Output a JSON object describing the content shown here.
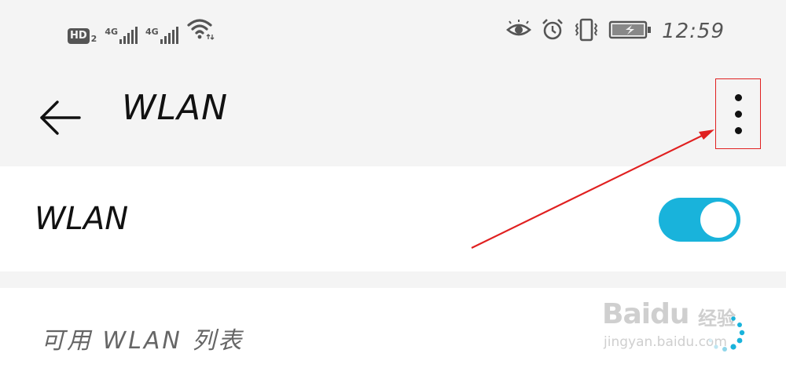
{
  "status_bar": {
    "hd_label": "HD",
    "hd_sub": "2",
    "signal1_label": "4G",
    "signal2_label": "4G",
    "time": "12:59"
  },
  "app_bar": {
    "title": "WLAN"
  },
  "wlan_toggle": {
    "label": "WLAN",
    "state": "on",
    "accent_color": "#19b3db"
  },
  "list_section": {
    "label": "可用 WLAN 列表"
  },
  "watermark": {
    "logo": "Baidu",
    "cn": "经验",
    "url": "jingyan.baidu.com"
  },
  "annotation": {
    "color": "#e02020"
  }
}
